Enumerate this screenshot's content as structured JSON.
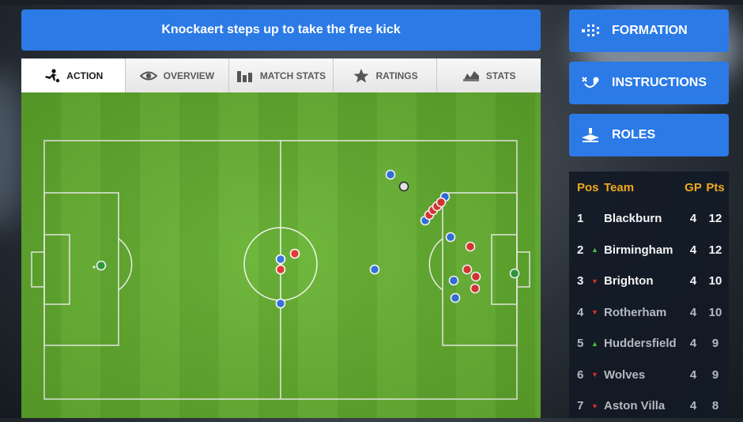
{
  "banner": {
    "text": "Knockaert steps up to take the free kick"
  },
  "tabs": [
    {
      "label": "ACTION",
      "icon": "kick-icon"
    },
    {
      "label": "OVERVIEW",
      "icon": "eye-icon"
    },
    {
      "label": "MATCH STATS",
      "icon": "bar-chart-icon"
    },
    {
      "label": "RATINGS",
      "icon": "star-icon"
    },
    {
      "label": "STATS",
      "icon": "stats-icon"
    }
  ],
  "side_buttons": [
    {
      "label": "FORMATION",
      "icon": "formation-icon"
    },
    {
      "label": "INSTRUCTIONS",
      "icon": "instructions-icon"
    },
    {
      "label": "ROLES",
      "icon": "roles-icon"
    }
  ],
  "league_table": {
    "headers": {
      "pos": "Pos",
      "team": "Team",
      "gp": "GP",
      "pts": "Pts"
    },
    "rows": [
      {
        "pos": "1",
        "movement": "none",
        "team": "Blackburn",
        "gp": "4",
        "pts": "12"
      },
      {
        "pos": "2",
        "movement": "up",
        "team": "Birmingham",
        "gp": "4",
        "pts": "12"
      },
      {
        "pos": "3",
        "movement": "down",
        "team": "Brighton",
        "gp": "4",
        "pts": "10"
      },
      {
        "pos": "4",
        "movement": "down",
        "team": "Rotherham",
        "gp": "4",
        "pts": "10"
      },
      {
        "pos": "5",
        "movement": "up",
        "team": "Huddersfield",
        "gp": "4",
        "pts": "9"
      },
      {
        "pos": "6",
        "movement": "down",
        "team": "Wolves",
        "gp": "4",
        "pts": "9"
      },
      {
        "pos": "7",
        "movement": "down",
        "team": "Aston Villa",
        "gp": "4",
        "pts": "8"
      }
    ]
  },
  "colors": {
    "accent": "#2b7ae6",
    "home_team": "#2f6fe0",
    "away_team": "#e0312b",
    "goalkeeper": "#2e9e3a",
    "header_text": "#f0a81e",
    "arrow_up": "#4ec243",
    "arrow_down": "#d8302a"
  }
}
